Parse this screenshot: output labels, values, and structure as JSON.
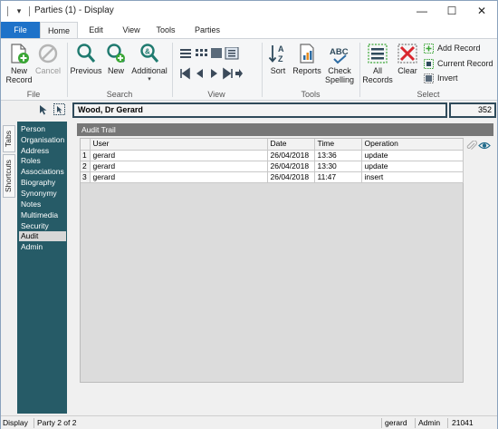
{
  "window": {
    "title": "Parties (1) - Display",
    "qa_glyph": "▾",
    "minimize": "—",
    "maximize": "☐",
    "close": "✕"
  },
  "ribbon_tabs": [
    {
      "label": "File"
    },
    {
      "label": "Home"
    },
    {
      "label": "Edit"
    },
    {
      "label": "View"
    },
    {
      "label": "Tools"
    },
    {
      "label": "Parties"
    }
  ],
  "ribbon": {
    "file_group": {
      "label": "File",
      "new_record": "New\nRecord",
      "cancel": "Cancel"
    },
    "search_group": {
      "label": "Search",
      "previous": "Previous",
      "new": "New",
      "additional": "Additional"
    },
    "view_group": {
      "label": "View"
    },
    "tools_group": {
      "label": "Tools",
      "sort": "Sort",
      "reports": "Reports",
      "check_spelling": "Check\nSpelling"
    },
    "select_group": {
      "label": "Select",
      "all_records": "All\nRecords",
      "clear": "Clear",
      "add_record": "Add Record",
      "current_record": "Current Record",
      "invert": "Invert"
    }
  },
  "side_tabs": [
    "Tabs",
    "Shortcuts"
  ],
  "nav": {
    "items": [
      {
        "label": "Person"
      },
      {
        "label": "Organisation"
      },
      {
        "label": "Address"
      },
      {
        "label": "Roles"
      },
      {
        "label": "Associations"
      },
      {
        "label": "Biography"
      },
      {
        "label": "Synonymy"
      },
      {
        "label": "Notes"
      },
      {
        "label": "Multimedia"
      },
      {
        "label": "Security"
      },
      {
        "label": "Audit"
      },
      {
        "label": "Admin"
      }
    ],
    "selected": "Audit"
  },
  "record": {
    "name": "Wood, Dr Gerard",
    "id": "352"
  },
  "section_title": "Audit Trail",
  "audit_table": {
    "columns": [
      "User",
      "Date",
      "Time",
      "Operation"
    ],
    "rows": [
      {
        "n": "1",
        "user": "gerard",
        "date": "26/04/2018",
        "time": "13:36",
        "operation": "update"
      },
      {
        "n": "2",
        "user": "gerard",
        "date": "26/04/2018",
        "time": "13:30",
        "operation": "update"
      },
      {
        "n": "3",
        "user": "gerard",
        "date": "26/04/2018",
        "time": "11:47",
        "operation": "insert"
      }
    ]
  },
  "status": {
    "mode": "Display",
    "position": "Party 2 of 2",
    "user": "gerard",
    "role": "Admin",
    "code": "21041"
  },
  "colors": {
    "accent": "#1e72c9",
    "nav_background": "#265b67",
    "section_header": "#777777",
    "record_border": "#2f4a5a"
  }
}
